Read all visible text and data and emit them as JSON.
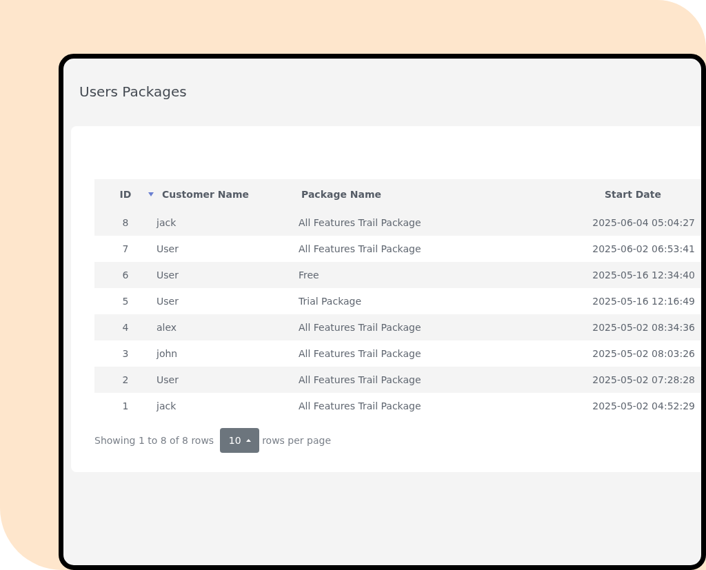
{
  "page": {
    "title": "Users Packages"
  },
  "table": {
    "columns": [
      "ID",
      "Customer Name",
      "Package Name",
      "Start Date"
    ],
    "rows": [
      {
        "id": "8",
        "customer": "jack",
        "package": "All Features Trail Package",
        "start": "2025-06-04 05:04:27"
      },
      {
        "id": "7",
        "customer": "User",
        "package": "All Features Trail Package",
        "start": "2025-06-02 06:53:41"
      },
      {
        "id": "6",
        "customer": "User",
        "package": "Free",
        "start": "2025-05-16 12:34:40"
      },
      {
        "id": "5",
        "customer": "User",
        "package": "Trial Package",
        "start": "2025-05-16 12:16:49"
      },
      {
        "id": "4",
        "customer": "alex",
        "package": "All Features Trail Package",
        "start": "2025-05-02 08:34:36"
      },
      {
        "id": "3",
        "customer": "john",
        "package": "All Features Trail Package",
        "start": "2025-05-02 08:03:26"
      },
      {
        "id": "2",
        "customer": "User",
        "package": "All Features Trail Package",
        "start": "2025-05-02 07:28:28"
      },
      {
        "id": "1",
        "customer": "jack",
        "package": "All Features Trail Package",
        "start": "2025-05-02 04:52:29"
      }
    ]
  },
  "pagination": {
    "summary": "Showing 1 to 8 of 8 rows",
    "page_size": "10",
    "suffix": "rows per page"
  }
}
